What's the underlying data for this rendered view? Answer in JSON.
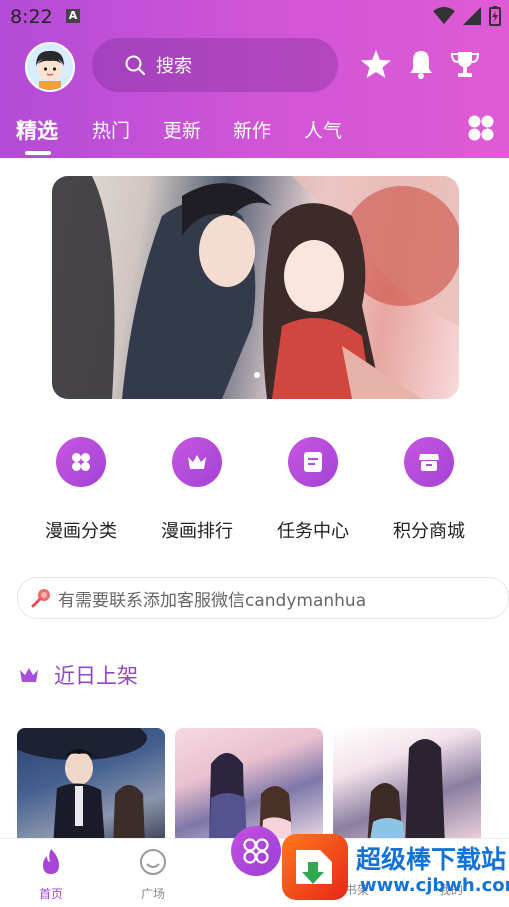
{
  "status_bar": {
    "time": "8:22",
    "a_badge": "A"
  },
  "header": {
    "search_placeholder": "搜索",
    "icons": [
      "star-icon",
      "bell-icon",
      "trophy-icon"
    ],
    "tabs": [
      {
        "label": "精选",
        "active": true
      },
      {
        "label": "热门",
        "active": false
      },
      {
        "label": "更新",
        "active": false
      },
      {
        "label": "新作",
        "active": false
      },
      {
        "label": "人气",
        "active": false
      }
    ]
  },
  "quick_actions": [
    {
      "label": "漫画分类",
      "icon": "four-petal-icon"
    },
    {
      "label": "漫画排行",
      "icon": "crown-icon"
    },
    {
      "label": "任务中心",
      "icon": "document-icon"
    },
    {
      "label": "积分商城",
      "icon": "store-icon"
    }
  ],
  "notice": {
    "text": "有需要联系添加客服微信candymanhua"
  },
  "section": {
    "title": "近日上架"
  },
  "bottom_nav": [
    {
      "label": "首页",
      "active": true
    },
    {
      "label": "广场",
      "active": false
    },
    {
      "label": "书架",
      "active": false
    },
    {
      "label": "我的",
      "active": false
    }
  ],
  "watermark": {
    "title": "超级棒下载站",
    "url": "www.cjbwh.com"
  },
  "colors": {
    "accent": "#a845d8",
    "header_start": "#b34bd6",
    "header_end": "#e05ad6"
  }
}
